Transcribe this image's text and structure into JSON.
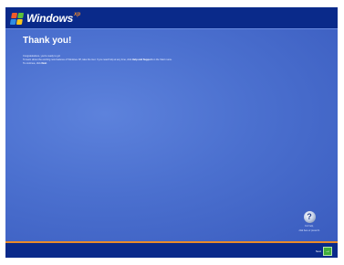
{
  "header": {
    "logo_text": "Windows",
    "logo_xp": "xp"
  },
  "main": {
    "title": "Thank you!",
    "paragraphs": [
      "Congratulations, you're ready to go!",
      "To learn about the exciting new features of Windows XP, take the tour. If you need help at any time, click Help and Support on the Start menu.",
      "To continue, click Next."
    ],
    "bold_terms": [
      "Help and Support",
      "Next"
    ]
  },
  "help": {
    "icon": "question-mark-icon",
    "glyph": "?",
    "label_line1": "For help,",
    "label_line2": "click here or press F1"
  },
  "footer": {
    "next_label": "Next",
    "next_glyph": "→"
  },
  "colors": {
    "background": "#4b70cf",
    "bars": "#0a2a8a",
    "accent_line": "#e98a2a",
    "next_button": "#3fae3a"
  }
}
